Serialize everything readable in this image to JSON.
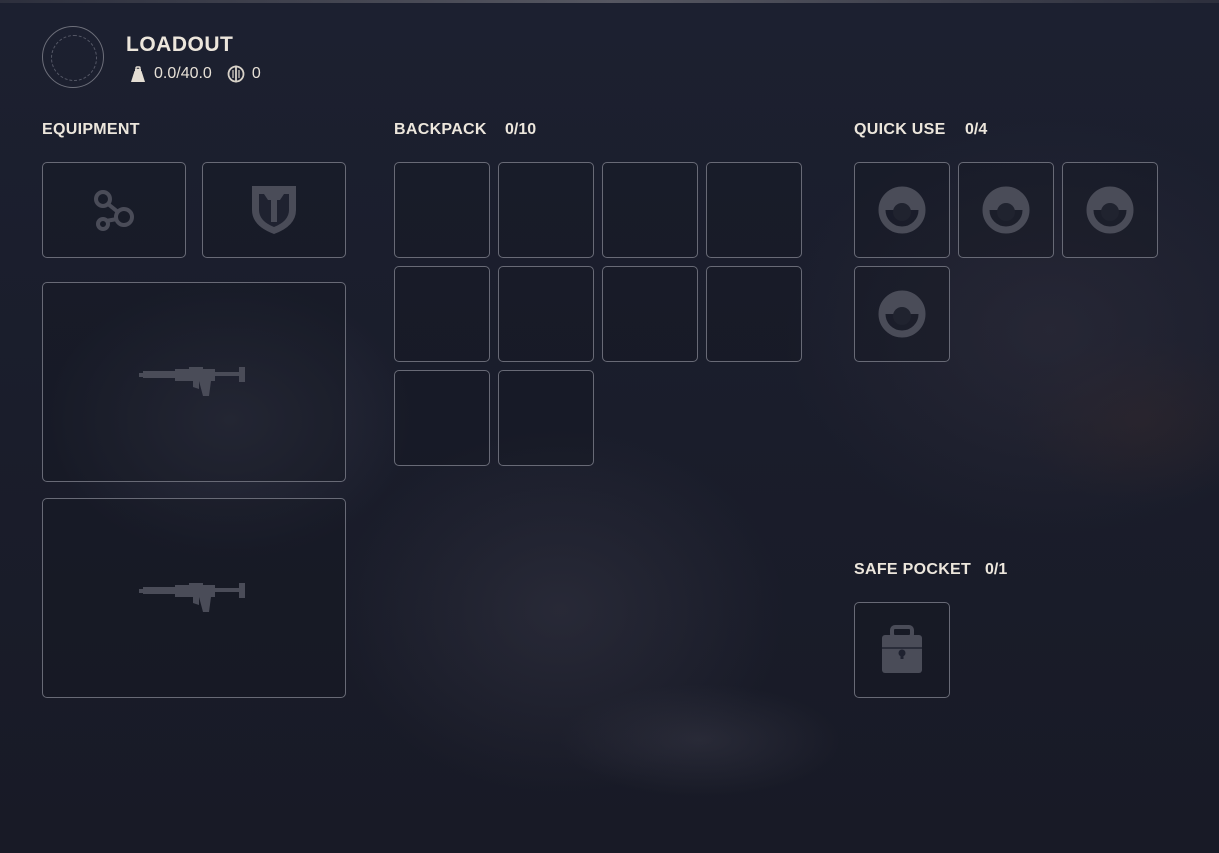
{
  "header": {
    "title": "LOADOUT",
    "weight": "0.0/40.0",
    "currency": "0",
    "icons": {
      "avatar": "empty-avatar-icon",
      "weight": "weight-bag-icon",
      "currency": "coin-icon"
    }
  },
  "equipment": {
    "label": "EQUIPMENT",
    "slots": [
      {
        "icon": "augment-icon"
      },
      {
        "icon": "shield-icon"
      },
      {
        "icon": "rifle-icon"
      },
      {
        "icon": "rifle-icon"
      }
    ]
  },
  "backpack": {
    "label": "BACKPACK",
    "count": "0/10",
    "slot_count": 10
  },
  "quick_use": {
    "label": "QUICK USE",
    "count": "0/4",
    "slot_icon": "consumable-icon",
    "slot_count": 4
  },
  "safe_pocket": {
    "label": "SAFE POCKET",
    "count": "0/1",
    "slot_icon": "lock-icon",
    "slot_count": 1
  },
  "colors": {
    "text": "#ece6dc",
    "slot_border": "#686a76",
    "icon": "#4a4c58",
    "background": "#1b1e2c"
  }
}
